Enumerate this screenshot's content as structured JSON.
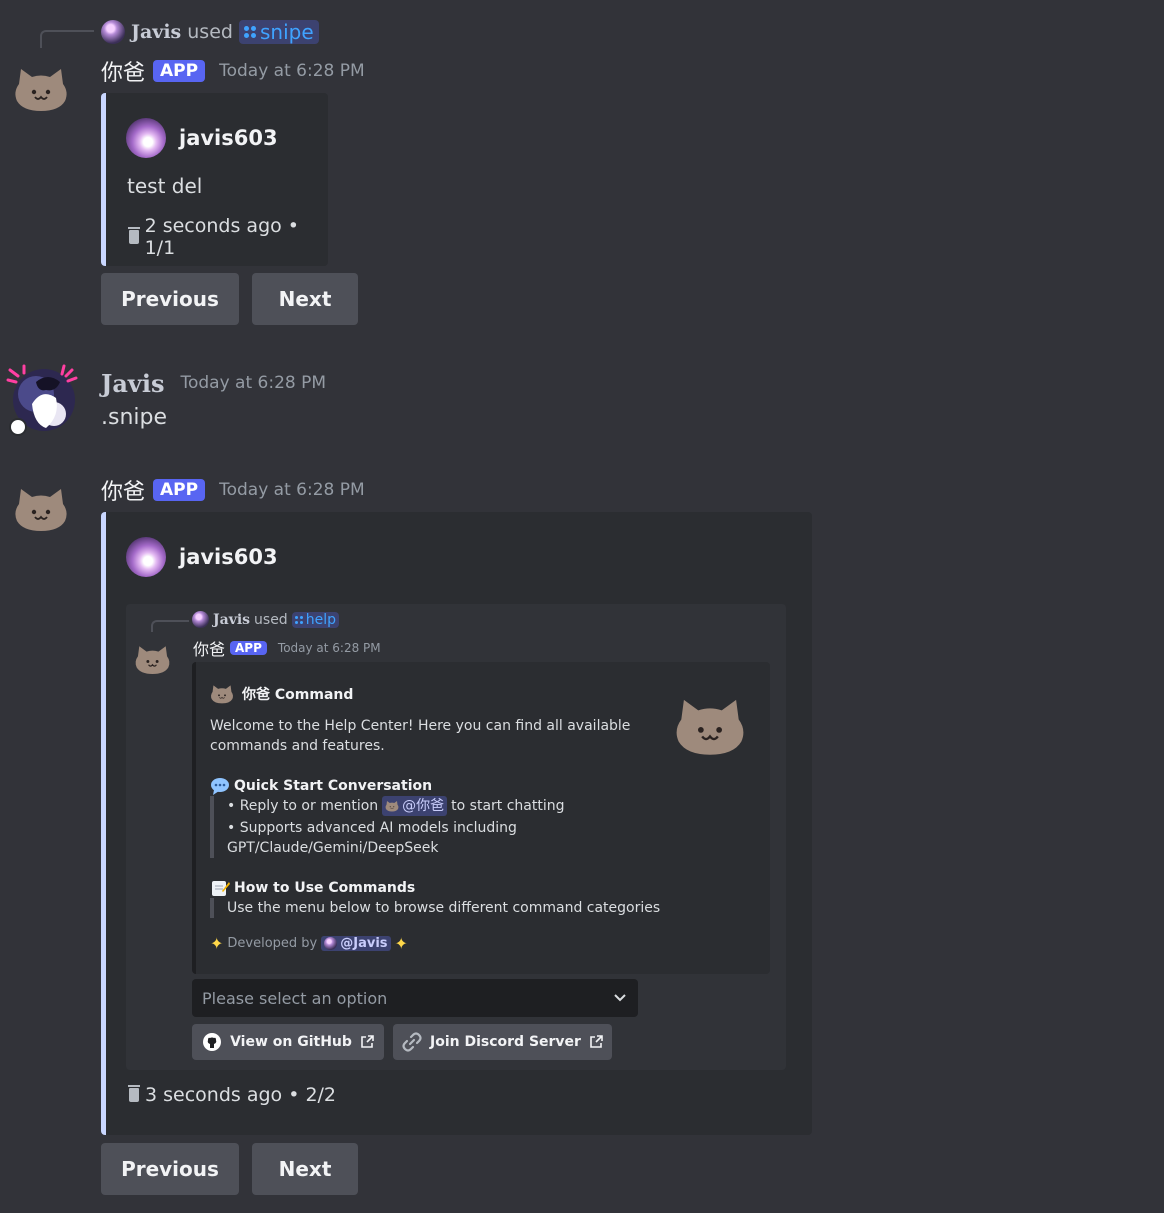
{
  "msg1": {
    "reply": {
      "user": "Javis",
      "used": "used",
      "command": "snipe"
    },
    "author": "你爸",
    "app_tag": "APP",
    "timestamp": "Today at 6:28 PM",
    "embed": {
      "author": "javis603",
      "description": "test del",
      "footer": "2 seconds ago • 1/1"
    },
    "buttons": {
      "prev": "Previous",
      "next": "Next"
    }
  },
  "msg2": {
    "author": "Javis",
    "timestamp": "Today at 6:28 PM",
    "content": ".snipe"
  },
  "msg3": {
    "author": "你爸",
    "app_tag": "APP",
    "timestamp": "Today at 6:28 PM",
    "embed": {
      "author": "javis603",
      "footer": "3 seconds ago • 2/2"
    },
    "buttons": {
      "prev": "Previous",
      "next": "Next"
    }
  },
  "inner": {
    "reply": {
      "user": "Javis",
      "used": "used",
      "command": "help"
    },
    "author": "你爸",
    "app_tag": "APP",
    "timestamp": "Today at 6:28 PM",
    "embed_title": "你爸 Command",
    "desc_line1": "Welcome to the Help Center! Here you can find all available",
    "desc_line2": "commands and features.",
    "quick_title": "Quick Start Conversation",
    "quick_b1_pre": "• Reply to or mention",
    "quick_b1_mention": "@你爸",
    "quick_b1_post": "to start chatting",
    "quick_b2_l1": "• Supports advanced AI models including",
    "quick_b2_l2": "GPT/Claude/Gemini/DeepSeek",
    "howto_title": "How to Use Commands",
    "howto_text": "Use the menu below to browse different command categories",
    "dev_text": "Developed by",
    "dev_mention": "@Javis",
    "select_placeholder": "Please select an option",
    "github_btn": "View on GitHub",
    "discord_btn": "Join Discord Server"
  },
  "colors": {
    "background": "#323339",
    "blurple": "#5865f2",
    "embed_bar": "#c9d7ff",
    "command_link": "#3fa3ff"
  }
}
